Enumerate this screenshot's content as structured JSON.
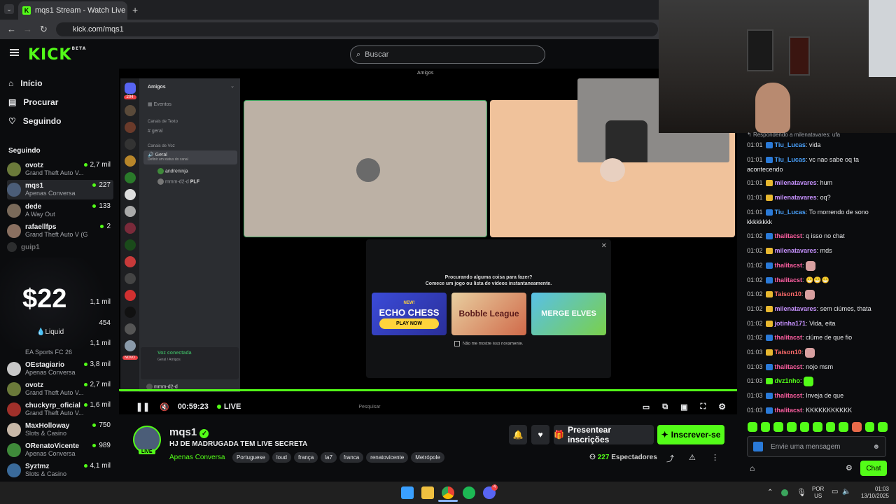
{
  "browser": {
    "tab_title": "mqs1 Stream - Watch Live on K",
    "url": "kick.com/mqs1"
  },
  "header": {
    "logo": "KICK",
    "logo_badge": "BETA",
    "search_placeholder": "Buscar"
  },
  "sidebar": {
    "nav": [
      {
        "label": "Início",
        "icon": "home-icon"
      },
      {
        "label": "Procurar",
        "icon": "browse-icon"
      },
      {
        "label": "Seguindo",
        "icon": "heart-icon"
      }
    ],
    "following_title": "Seguindo",
    "channels_top": [
      {
        "name": "ovotz",
        "category": "Grand Theft Auto V...",
        "viewers": "2,7 mil"
      },
      {
        "name": "mqs1",
        "category": "Apenas Conversa",
        "viewers": "227"
      },
      {
        "name": "dede",
        "category": "A Way Out",
        "viewers": "133"
      },
      {
        "name": "rafaellfps",
        "category": "Grand Theft Auto V (GTA)",
        "viewers": "2"
      },
      {
        "name": "guip1",
        "category": "",
        "viewers": ""
      }
    ],
    "ad_amount": "$22",
    "ad_brand": "Liquid",
    "ad_side_values": [
      "1,1 mil",
      "454",
      "1,1 mil"
    ],
    "ad_under_category": "EA Sports FC 26",
    "channels_bottom": [
      {
        "name": "OEstagiario",
        "category": "Apenas Conversa",
        "viewers": "3,8 mil"
      },
      {
        "name": "ovotz",
        "category": "Grand Theft Auto V...",
        "viewers": "2,7 mil"
      },
      {
        "name": "chuckyrp_oficial",
        "category": "Grand Theft Auto V...",
        "viewers": "1,6 mil"
      },
      {
        "name": "MaxHolloway",
        "category": "Slots & Casino",
        "viewers": "750"
      },
      {
        "name": "ORenatoVicente",
        "category": "Apenas Conversa",
        "viewers": "989"
      },
      {
        "name": "Syztmz",
        "category": "Slots & Casino",
        "viewers": "4,1 mil"
      }
    ]
  },
  "video": {
    "discord": {
      "top_title": "Amigos",
      "server_title": "Amigos",
      "events": "Eventos",
      "text_channels": "Canais de Texto",
      "text_channel": "geral",
      "voice_channels": "Canais de Voz",
      "voice_channel": "Geral",
      "voice_sub": "Definir um status do canal",
      "members": [
        "andreninja",
        "mmm-d2-d"
      ],
      "member_tag": "PLF",
      "voice_connected": "Voz conectada",
      "voice_path": "Geral / Amigos",
      "user": "mmm-d2-d",
      "badge_count": "204",
      "novo": "NOVO"
    },
    "activity_popup": {
      "title": "Procurando alguma coisa para fazer?",
      "subtitle": "Comece um jogo ou lista de vídeos instantaneamente.",
      "games": [
        "ECHO CHESS",
        "Bobble League",
        "MERGE ELVES"
      ],
      "game_badge": "NEW!",
      "play_now": "PLAY NOW",
      "checkbox_label": "Não me mostre isso novamente."
    },
    "player": {
      "elapsed": "00:59:23",
      "live_label": "LIVE",
      "progress": 1.0,
      "os_search": "Pesquisar"
    }
  },
  "stream_info": {
    "streamer": "mqs1",
    "title": "HJ DE MADRUGADA TEM LIVE SECRETA",
    "category": "Apenas Conversa",
    "tags": [
      "Portuguese",
      "loud",
      "frança",
      "la7",
      "franca",
      "renatovicente",
      "Metrópole"
    ],
    "avatar_live": "LIVE",
    "gift_button": "Presentear inscrições",
    "subscribe_button": "Inscrever-se",
    "viewers": "227",
    "viewers_label": "Espectadores"
  },
  "chat": {
    "reply_banner": "Respondendo a milenatavares: ufa",
    "messages": [
      {
        "time": "01:01",
        "user": "Tiu_Lucas",
        "color": "#4aa3ff",
        "text": "vida"
      },
      {
        "time": "01:01",
        "user": "Tiu_Lucas",
        "color": "#4aa3ff",
        "text": "vc nao sabe oq ta acontecendo"
      },
      {
        "time": "01:01",
        "user": "milenatavares",
        "color": "#c792ff",
        "text": "hum"
      },
      {
        "time": "01:01",
        "user": "milenatavares",
        "color": "#c792ff",
        "text": "oq?"
      },
      {
        "time": "01:01",
        "user": "Tiu_Lucas",
        "color": "#4aa3ff",
        "text": "To morrendo de sono kkkkkkkk"
      },
      {
        "time": "01:02",
        "user": "thalitacst",
        "color": "#ff5fa2",
        "text": "q isso no chat"
      },
      {
        "time": "01:02",
        "user": "milenatavares",
        "color": "#c792ff",
        "text": "mds"
      },
      {
        "time": "01:02",
        "user": "thalitacst",
        "color": "#ff5fa2",
        "text": ""
      },
      {
        "time": "01:02",
        "user": "thalitacst",
        "color": "#ff5fa2",
        "text": "😁😁😁"
      },
      {
        "time": "01:02",
        "user": "Taison10",
        "color": "#ff6b6b",
        "text": ""
      },
      {
        "time": "01:02",
        "user": "milenatavares",
        "color": "#c792ff",
        "text": "sem ciúmes, thata"
      },
      {
        "time": "01:02",
        "user": "jotinha171",
        "color": "#c792ff",
        "text": "Vida, eita"
      },
      {
        "time": "01:02",
        "user": "thalitacst",
        "color": "#ff5fa2",
        "text": "ciúme de que fio"
      },
      {
        "time": "01:03",
        "user": "Taison10",
        "color": "#ff6b6b",
        "text": ""
      },
      {
        "time": "01:03",
        "user": "thalitacst",
        "color": "#ff5fa2",
        "text": "nojo msm"
      },
      {
        "time": "01:03",
        "user": "dvz1nho",
        "color": "#53fc18",
        "text": ""
      },
      {
        "time": "01:03",
        "user": "thalitacst",
        "color": "#ff5fa2",
        "text": "Inveja de que"
      },
      {
        "time": "01:03",
        "user": "thalitacst",
        "color": "#ff5fa2",
        "text": "KKKKKKKKKKK"
      }
    ],
    "input_placeholder": "Envie uma mensagem",
    "send_button": "Chat"
  },
  "taskbar": {
    "lang": "POR",
    "region": "US",
    "time": "01:03",
    "date": "13/10/2025",
    "discord_badge": "4"
  },
  "colors": {
    "kick_green": "#53fc18",
    "background": "#0b0c0e"
  }
}
